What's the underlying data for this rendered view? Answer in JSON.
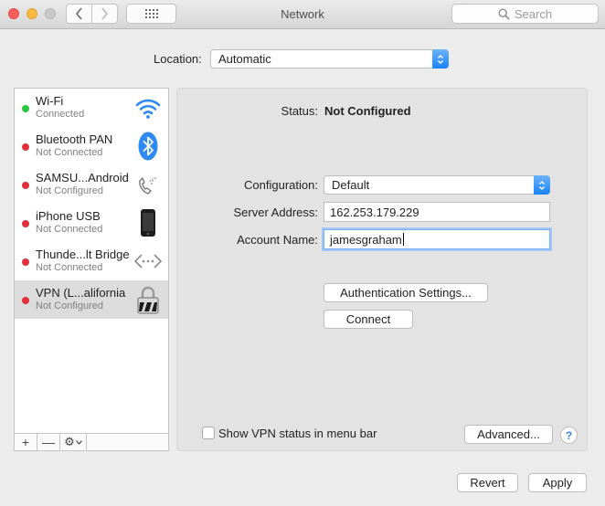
{
  "window": {
    "title": "Network",
    "search_placeholder": "Search"
  },
  "location": {
    "label": "Location:",
    "value": "Automatic"
  },
  "services": [
    {
      "name": "Wi-Fi",
      "status": "Connected",
      "status_color": "#2ac840",
      "icon": "wifi-icon"
    },
    {
      "name": "Bluetooth PAN",
      "status": "Not Connected",
      "status_color": "#e0313b",
      "icon": "bluetooth-icon"
    },
    {
      "name": "SAMSU...Android",
      "status": "Not Configured",
      "status_color": "#e0313b",
      "icon": "phone-handset-icon"
    },
    {
      "name": "iPhone USB",
      "status": "Not Connected",
      "status_color": "#e0313b",
      "icon": "iphone-icon"
    },
    {
      "name": "Thunde...lt Bridge",
      "status": "Not Connected",
      "status_color": "#e0313b",
      "icon": "thunderbolt-bridge-icon"
    },
    {
      "name": "VPN (L...alifornia",
      "status": "Not Configured",
      "status_color": "#e0313b",
      "icon": "vpn-lock-icon",
      "selected": true
    }
  ],
  "sidebar_toolbar": {
    "add": "+",
    "remove": "—",
    "gear": "⚙"
  },
  "detail": {
    "status_label": "Status:",
    "status_value": "Not Configured",
    "configuration_label": "Configuration:",
    "configuration_value": "Default",
    "server_label": "Server Address:",
    "server_value": "162.253.179.229",
    "account_label": "Account Name:",
    "account_value": "jamesgraham",
    "auth_button": "Authentication Settings...",
    "connect_button": "Connect",
    "show_vpn_label": "Show VPN status in menu bar",
    "show_vpn_checked": false,
    "advanced_button": "Advanced...",
    "help": "?"
  },
  "footer": {
    "revert": "Revert",
    "apply": "Apply"
  },
  "colors": {
    "accent": "#1a82fb",
    "connected": "#2ac840",
    "disconnected": "#e0313b"
  }
}
